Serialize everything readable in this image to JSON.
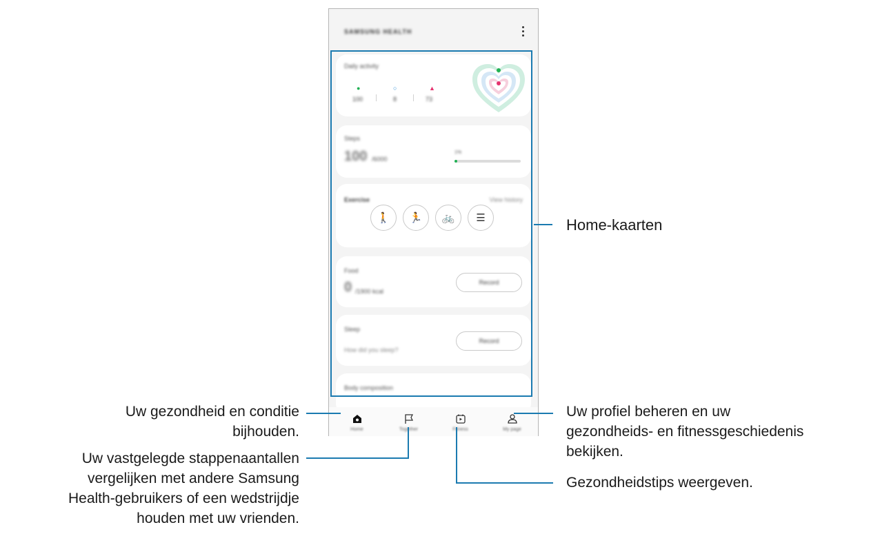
{
  "app": {
    "title": "SAMSUNG HEALTH"
  },
  "daily_activity": {
    "title": "Daily activity",
    "steps": "100",
    "minutes": "8",
    "calories": "73",
    "colors": {
      "steps": "#21b154",
      "minutes": "#2f8fd8",
      "calories": "#e5336f"
    }
  },
  "steps_card": {
    "title": "Steps",
    "value": "100",
    "unit": "/6000",
    "progress_label": "1%",
    "progress_fraction": 0.02
  },
  "exercise_card": {
    "title": "Exercise",
    "link": "View history",
    "buttons": [
      "walking-icon",
      "running-icon",
      "cycling-icon",
      "list-icon"
    ]
  },
  "food_card": {
    "title": "Food",
    "value": "0",
    "unit": "/1900 kcal",
    "button": "Record"
  },
  "sleep_card": {
    "title": "Sleep",
    "subtitle": "How did you sleep?",
    "button": "Record"
  },
  "body_card": {
    "title": "Body composition"
  },
  "nav": {
    "home": "Home",
    "together": "Together",
    "fitness": "Fitness",
    "my_page": "My page"
  },
  "callouts": {
    "home_cards": "Home-kaarten",
    "home_line1": "Uw gezondheid en conditie",
    "home_line2": "bijhouden.",
    "together_line1": "Uw vastgelegde stappenaantallen",
    "together_line2": "vergelijken met andere Samsung",
    "together_line3": "Health-gebruikers of een wedstrijdje",
    "together_line4": "houden met uw vrienden.",
    "profile_line1": "Uw profiel beheren en uw",
    "profile_line2": "gezondheids- en fitnessgeschiedenis",
    "profile_line3": "bekijken.",
    "fitness": "Gezondheidstips weergeven."
  },
  "colors": {
    "accent_line": "#1a7ab0"
  }
}
